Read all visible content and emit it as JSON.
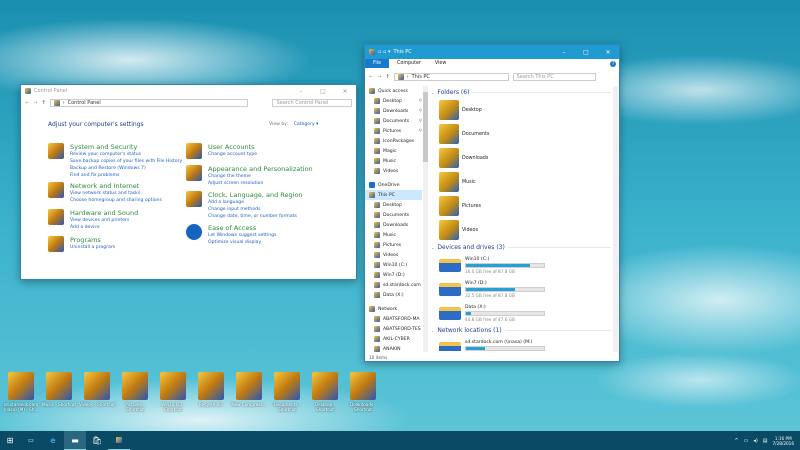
{
  "control_panel": {
    "title": "Control Panel",
    "breadcrumb": "Control Panel",
    "search_placeholder": "Search Control Panel",
    "heading": "Adjust your computer's settings",
    "view_by_label": "View by:",
    "view_by_value": "Category",
    "categories": [
      {
        "title": "System and Security",
        "links": [
          "Review your computer's status",
          "Save backup copies of your files with File History",
          "Backup and Restore (Windows 7)",
          "Find and fix problems"
        ]
      },
      {
        "title": "Network and Internet",
        "links": [
          "View network status and tasks",
          "Choose homegroup and sharing options"
        ]
      },
      {
        "title": "Hardware and Sound",
        "links": [
          "View devices and printers",
          "Add a device"
        ]
      },
      {
        "title": "Programs",
        "links": [
          "Uninstall a program"
        ]
      },
      {
        "title": "User Accounts",
        "links": [
          "Change account type"
        ]
      },
      {
        "title": "Appearance and Personalization",
        "links": [
          "Change the theme",
          "Adjust screen resolution"
        ]
      },
      {
        "title": "Clock, Language, and Region",
        "links": [
          "Add a language",
          "Change input methods",
          "Change date, time, or number formats"
        ]
      },
      {
        "title": "Ease of Access",
        "links": [
          "Let Windows suggest settings",
          "Optimize visual display"
        ]
      }
    ]
  },
  "explorer": {
    "title": "This PC",
    "ribbon_tabs": [
      "File",
      "Computer",
      "View"
    ],
    "breadcrumb": "This PC",
    "search_placeholder": "Search This PC",
    "nav": [
      "Quick access",
      "Desktop",
      "Downloads",
      "Documents",
      "Pictures",
      "IconPackages",
      "Magic",
      "Music",
      "Videos",
      "OneDrive",
      "This PC",
      "Desktop",
      "Documents",
      "Downloads",
      "Music",
      "Pictures",
      "Videos",
      "Win10 (C:)",
      "Win7 (D:)",
      "sd.stardock.com",
      "Data (X:)",
      "Network",
      "ABATSFORD-MA",
      "ABATSFORD-TES",
      "AKIL-CYBER",
      "ANAKIN"
    ],
    "folders_header": "Folders (6)",
    "folders": [
      "Desktop",
      "Documents",
      "Downloads",
      "Music",
      "Pictures",
      "Videos"
    ],
    "devices_header": "Devices and drives (3)",
    "drives": [
      {
        "name": "Win10 (C:)",
        "free": "16.0 GB free of 87.8 GB",
        "used_pct": 82
      },
      {
        "name": "Win7 (D:)",
        "free": "32.5 GB free of 87.8 GB",
        "used_pct": 63
      },
      {
        "name": "Data (X:)",
        "free": "44.8 GB free of 47.6 GB",
        "used_pct": 6
      }
    ],
    "network_header": "Network locations (1)",
    "network": [
      {
        "name": "sd.stardock.com (\\\\nasa) (M:)",
        "free": "11.0 TB free of 14.5 TB",
        "used_pct": 24
      }
    ],
    "status": "10 items"
  },
  "desktop_icons": [
    "sd.stardock.com (nasa) (M) - Sh...",
    "Music - Shortcut",
    "Videos - Shortcut",
    "Pictures - Shortcut",
    "Win10 (C) - Shortcut",
    "Recycle Bin",
    "New Compress...",
    "Documents - Shortcut",
    "Desktop - Shortcut",
    "Downloads - Shortcut"
  ],
  "taskbar": {
    "time": "1:16 PM",
    "date": "7/28/2016"
  }
}
